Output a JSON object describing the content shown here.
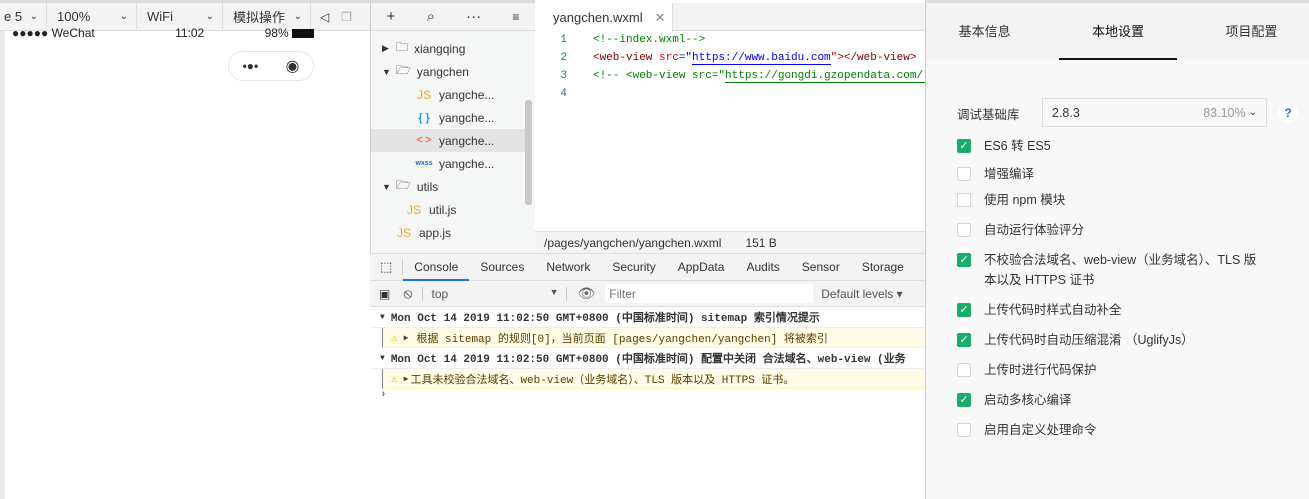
{
  "toolbar": {
    "device": "e 5",
    "zoom": "100%",
    "network": "WiFi",
    "mode": "模拟操作"
  },
  "phone": {
    "carrier": "●●●●● WeChat",
    "time": "11:02",
    "battery": "98%"
  },
  "tree": {
    "items": [
      {
        "label": "xiangqing",
        "type": "folder",
        "expanded": false
      },
      {
        "label": "yangchen",
        "type": "folder",
        "expanded": true
      },
      {
        "label": "yangche...",
        "type": "js",
        "icon": "JS"
      },
      {
        "label": "yangche...",
        "type": "json",
        "icon": "{ }"
      },
      {
        "label": "yangche...",
        "type": "wxml",
        "icon": "< >",
        "selected": true
      },
      {
        "label": "yangche...",
        "type": "wxss",
        "icon": "wxss"
      },
      {
        "label": "utils",
        "type": "folder",
        "expanded": true
      },
      {
        "label": "util.js",
        "type": "js",
        "icon": "JS"
      },
      {
        "label": "app.js",
        "type": "js",
        "icon": "JS"
      }
    ]
  },
  "editor": {
    "tab": "yangchen.wxml",
    "lines": [
      {
        "n": "1",
        "comment": "<!--index.wxml-->"
      },
      {
        "n": "2",
        "tag_open": "<web-view ",
        "attr": "src",
        "eq": "=\"",
        "url": "https://www.baidu.com",
        "close": "\"></web-view>"
      },
      {
        "n": "3",
        "comment": "<!-- <web-view src=\"",
        "url": "https://gongdi.gzopendata.com/:"
      },
      {
        "n": "4"
      }
    ],
    "path": "/pages/yangchen/yangchen.wxml",
    "size": "151 B"
  },
  "devtools": {
    "tabs": [
      "Console",
      "Sources",
      "Network",
      "Security",
      "AppData",
      "Audits",
      "Sensor",
      "Storage"
    ],
    "context": "top",
    "filter_placeholder": "Filter",
    "levels": "Default levels ▾",
    "logs": [
      {
        "type": "group",
        "text": "Mon Oct 14 2019 11:02:50 GMT+0800 (中国标准时间) sitemap 索引情况提示"
      },
      {
        "type": "warn",
        "text": "根据 sitemap 的规则[0]，当前页面 [pages/yangchen/yangchen] 将被索引"
      },
      {
        "type": "group",
        "text": "Mon Oct 14 2019 11:02:50 GMT+0800 (中国标准时间) 配置中关闭 合法域名、web-view (业务"
      },
      {
        "type": "warn",
        "text": "工具未校验合法域名、web-view（业务域名）、TLS 版本以及 HTTPS 证书。"
      }
    ]
  },
  "settings": {
    "tabs": [
      "基本信息",
      "本地设置",
      "项目配置"
    ],
    "active_tab": 1,
    "lib_label": "调试基础库",
    "lib_version": "2.8.3",
    "lib_percent": "83.10%",
    "help": "?",
    "options": [
      {
        "label": "ES6 转 ES5",
        "checked": true
      },
      {
        "label": "增强编译",
        "checked": false
      },
      {
        "label": "使用 npm 模块",
        "checked": false
      },
      {
        "label": "自动运行体验评分",
        "checked": false
      },
      {
        "label": "不校验合法域名、web-view（业务域名）、TLS 版本以及 HTTPS 证书",
        "checked": true
      },
      {
        "label": "上传代码时样式自动补全",
        "checked": true
      },
      {
        "label": "上传代码时自动压缩混淆 （UglifyJs）",
        "checked": true
      },
      {
        "label": "上传时进行代码保护",
        "checked": false
      },
      {
        "label": "启动多核心编译",
        "checked": true
      },
      {
        "label": "启用自定义处理命令",
        "checked": false
      }
    ]
  },
  "colors": {
    "accent": "#1aad6a",
    "tab_underline": "#1a73e8"
  }
}
